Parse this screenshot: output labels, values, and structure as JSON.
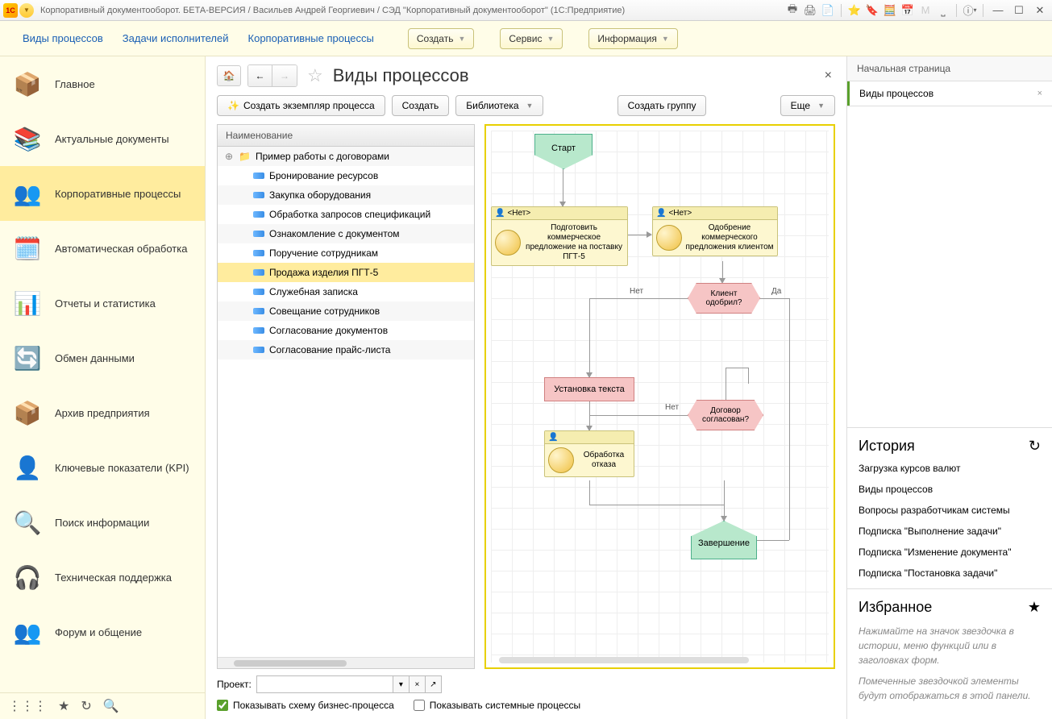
{
  "titlebar": {
    "logo": "1C",
    "title": "Корпоративный документооборот. БЕТА-ВЕРСИЯ / Васильев Андрей Георгиевич / СЭД \"Корпоративный документооборот\"  (1С:Предприятие)"
  },
  "menubar": {
    "link1": "Виды процессов",
    "link2": "Задачи исполнителей",
    "link3": "Корпоративные процессы",
    "btn_create": "Создать",
    "btn_service": "Сервис",
    "btn_info": "Информация"
  },
  "leftnav": {
    "items": [
      {
        "label": "Главное",
        "icon": "📦"
      },
      {
        "label": "Актуальные документы",
        "icon": "📚"
      },
      {
        "label": "Корпоративные процессы",
        "icon": "👥"
      },
      {
        "label": "Автоматическая обработка",
        "icon": "🗓️"
      },
      {
        "label": "Отчеты и статистика",
        "icon": "📊"
      },
      {
        "label": "Обмен данными",
        "icon": "🔄"
      },
      {
        "label": "Архив предприятия",
        "icon": "📦"
      },
      {
        "label": "Ключевые показатели (KPI)",
        "icon": "👤"
      },
      {
        "label": "Поиск информации",
        "icon": "🔍"
      },
      {
        "label": "Техническая поддержка",
        "icon": "🎧"
      },
      {
        "label": "Форум и общение",
        "icon": "👥"
      }
    ]
  },
  "main": {
    "title": "Виды процессов",
    "toolbar": {
      "create_instance": "Создать экземпляр процесса",
      "create": "Создать",
      "library": "Библиотека",
      "create_group": "Создать группу",
      "more": "Еще"
    },
    "tree": {
      "header": "Наименование",
      "rows": [
        {
          "label": "Пример работы с договорами",
          "folder": true
        },
        {
          "label": "Бронирование ресурсов"
        },
        {
          "label": "Закупка оборудования"
        },
        {
          "label": "Обработка запросов спецификаций"
        },
        {
          "label": "Ознакомление с документом"
        },
        {
          "label": "Поручение сотрудникам"
        },
        {
          "label": "Продажа изделия ПГТ-5",
          "selected": true
        },
        {
          "label": "Служебная записка"
        },
        {
          "label": "Совещание сотрудников"
        },
        {
          "label": "Согласование документов"
        },
        {
          "label": "Согласование прайс-листа"
        }
      ]
    },
    "diagram": {
      "start": "Старт",
      "task1_head": "<Нет>",
      "task1_text": "Подготовить коммерческое предложение на поставку ПГТ-5",
      "task2_head": "<Нет>",
      "task2_text": "Одобрение коммерческого предложения клиентом",
      "dec1": "Клиент одобрил?",
      "dec1_no": "Нет",
      "dec1_yes": "Да",
      "act1": "Установка текста",
      "dec2": "Договор согласован?",
      "dec2_no": "Нет",
      "task3_text": "Обработка отказа",
      "end": "Завершение"
    },
    "bottom": {
      "project_label": "Проект:",
      "show_scheme": "Показывать схему бизнес-процесса",
      "show_system": "Показывать системные процессы"
    }
  },
  "rightpanel": {
    "tab_home": "Начальная страница",
    "tab_current": "Виды процессов",
    "history_title": "История",
    "history": [
      "Загрузка курсов валют",
      "Виды процессов",
      "Вопросы разработчикам системы",
      "Подписка \"Выполнение задачи\"",
      "Подписка \"Изменение документа\"",
      "Подписка \"Постановка задачи\""
    ],
    "fav_title": "Избранное",
    "fav_hint1": "Нажимайте на значок звездочка в истории, меню функций или в заголовках форм.",
    "fav_hint2": "Помеченные звездочкой элементы будут отображаться в этой панели."
  }
}
